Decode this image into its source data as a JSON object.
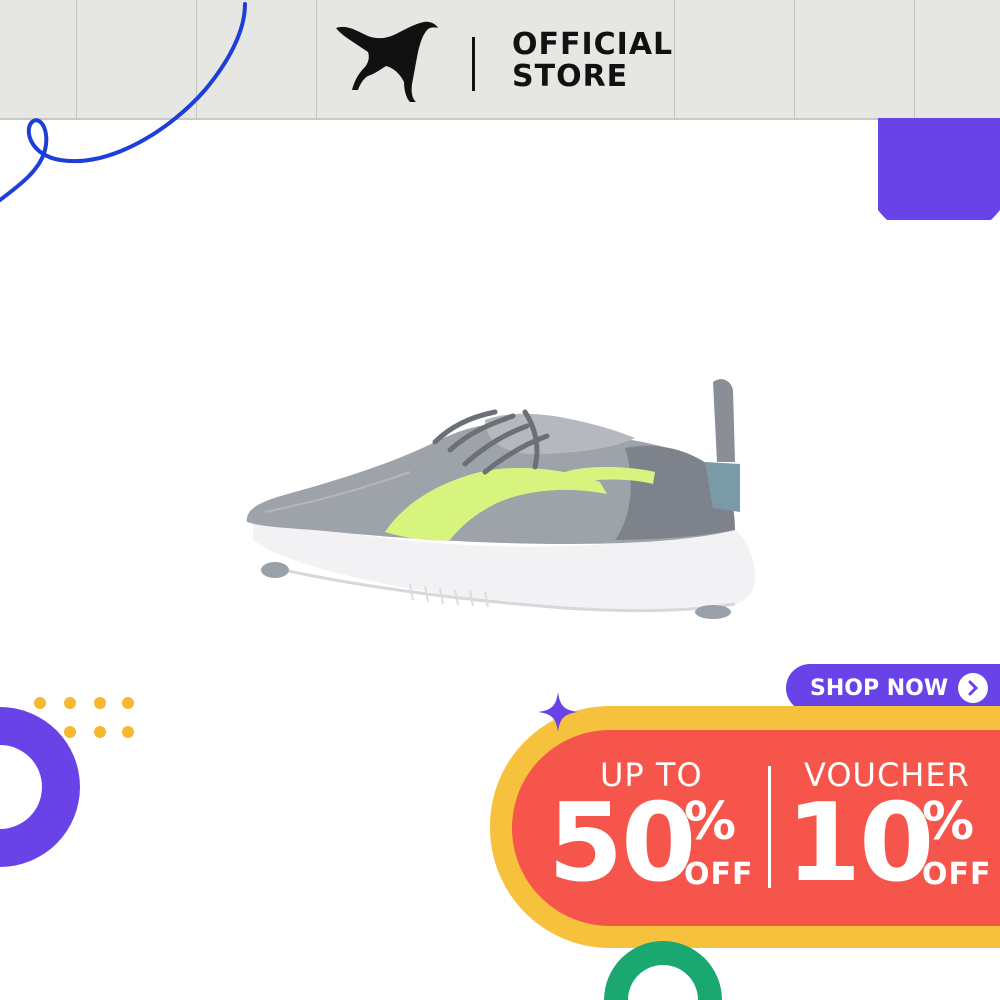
{
  "header": {
    "brand_icon": "puma-cat-logo",
    "title_line1": "OFFICIAL",
    "title_line2": "STORE"
  },
  "product": {
    "icon": "running-shoe-image"
  },
  "cta": {
    "label": "SHOP NOW",
    "icon": "chevron-right-icon"
  },
  "promo": {
    "left_label": "UP TO",
    "left_value": "50",
    "left_percent": "%",
    "left_off": "OFF",
    "right_label": "VOUCHER",
    "right_value": "10",
    "right_percent": "%",
    "right_off": "OFF"
  },
  "colors": {
    "header_bg": "#e6e6e2",
    "purple": "#6a43e8",
    "promo_red": "#f5554b",
    "promo_yellow": "#f6c23e",
    "ring_green": "#1aa870",
    "line_blue": "#1d3fd8",
    "dot_yellow": "#f5b82e"
  }
}
